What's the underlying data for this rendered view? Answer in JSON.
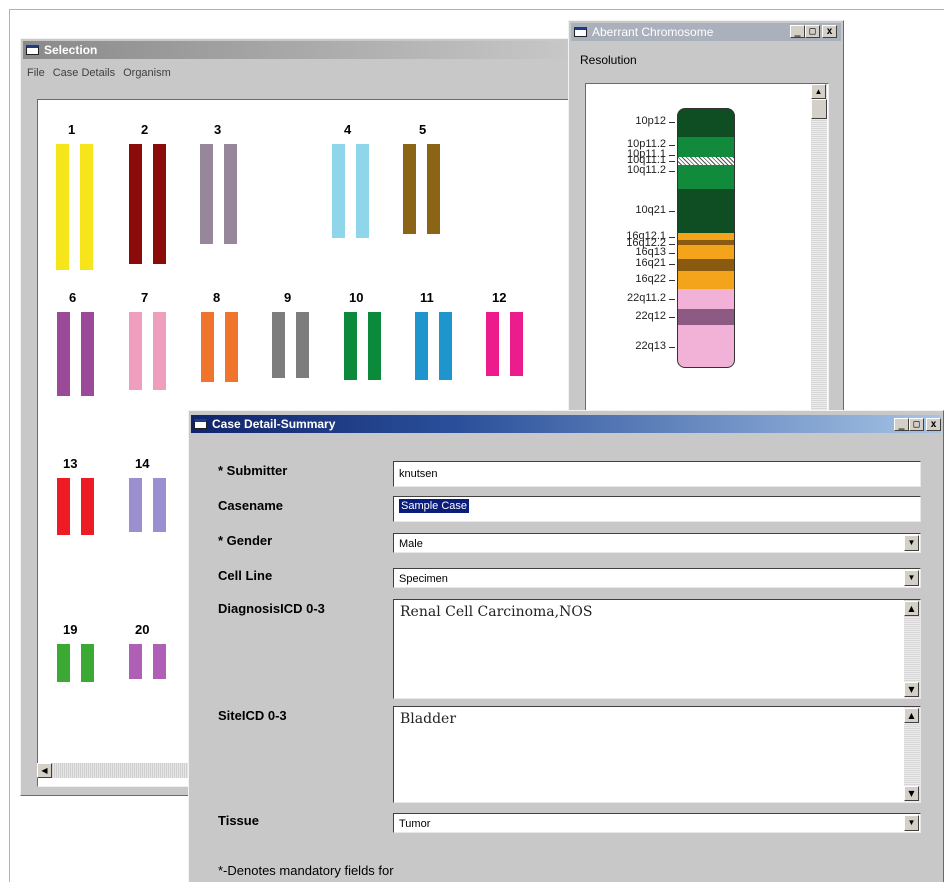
{
  "selection_window": {
    "title": "Selection",
    "menu": [
      "File",
      "Case Details",
      "Organism"
    ],
    "chromosomes": [
      {
        "label": "1",
        "color": "#f7e51c"
      },
      {
        "label": "2",
        "color": "#8b0b0b"
      },
      {
        "label": "3",
        "color": "#96879a"
      },
      {
        "label": "4",
        "color": "#8fd6ea"
      },
      {
        "label": "5",
        "color": "#8b6515"
      },
      {
        "label": "6",
        "color": "#9b4a99"
      },
      {
        "label": "7",
        "color": "#ef9fbd"
      },
      {
        "label": "8",
        "color": "#f0742b"
      },
      {
        "label": "9",
        "color": "#7d7d7d"
      },
      {
        "label": "10",
        "color": "#0a8a3a"
      },
      {
        "label": "11",
        "color": "#1f95cd"
      },
      {
        "label": "12",
        "color": "#ec1c8c"
      },
      {
        "label": "13",
        "color": "#ed1c24"
      },
      {
        "label": "14",
        "color": "#9b8fcf"
      },
      {
        "label": "19",
        "color": "#3aaa35"
      },
      {
        "label": "20",
        "color": "#b05fb6"
      }
    ]
  },
  "aberrant_window": {
    "title": "Aberrant Chromosome",
    "resolution_label": "Resolution",
    "band_labels": [
      "10p12",
      "10p11.2",
      "10p11.1",
      "10q11.1",
      "10q11.2",
      "10q21",
      "16q12.1",
      "16q12.2",
      "16q13",
      "16q21",
      "16q22",
      "22q11.2",
      "22q12",
      "22q13"
    ]
  },
  "case_window": {
    "title": "Case Detail-Summary",
    "fields": {
      "submitter": {
        "label": "* Submitter",
        "value": "knutsen"
      },
      "casename": {
        "label": "Casename",
        "value": "Sample Case"
      },
      "gender": {
        "label": "* Gender",
        "value": "Male"
      },
      "cell_line": {
        "label": "Cell Line",
        "value": "Specimen"
      },
      "diagnosis": {
        "label": "DiagnosisICD 0-3",
        "value": "Renal Cell Carcinoma,NOS"
      },
      "site": {
        "label": "SiteICD 0-3",
        "value": "Bladder"
      },
      "tissue": {
        "label": "Tissue",
        "value": "Tumor"
      }
    },
    "footnote": "*-Denotes mandatory fields for"
  },
  "window_buttons": {
    "minimize": "_",
    "maximize": "□",
    "close": "x"
  }
}
